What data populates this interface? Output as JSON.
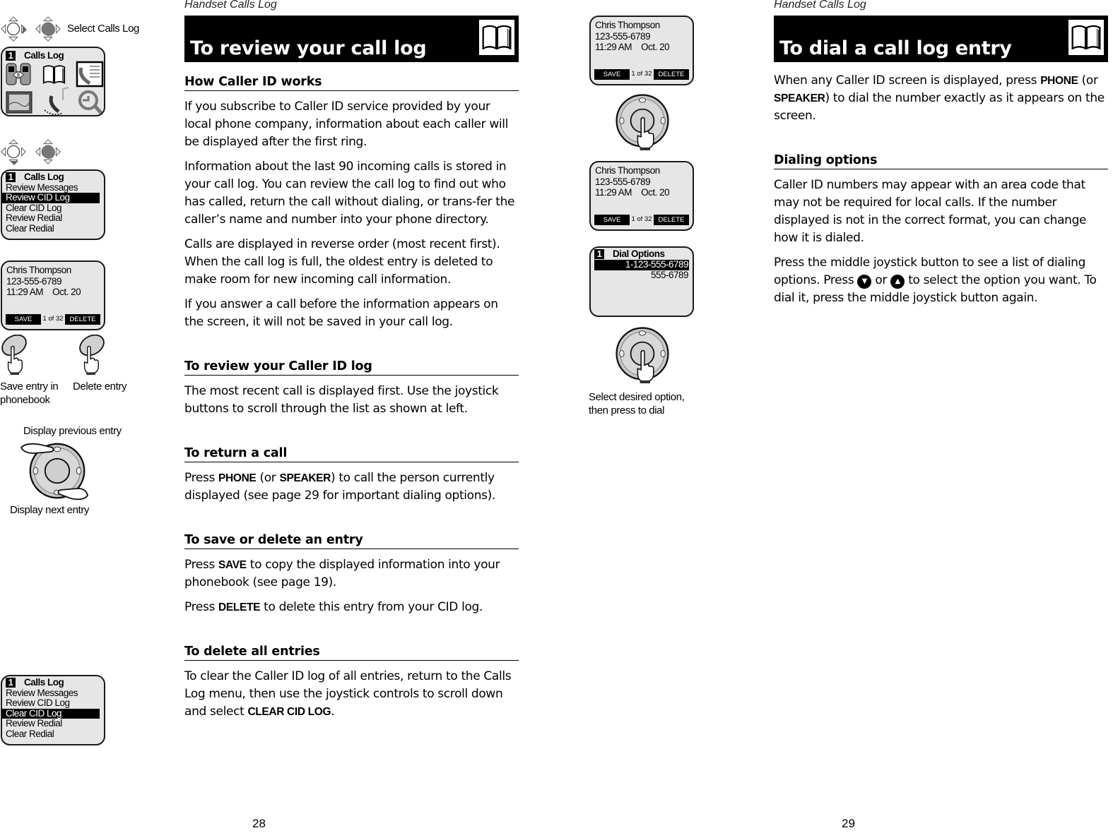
{
  "left_page": {
    "running_head": "Handset Calls Log",
    "page_number": "28",
    "banner_title": "To review your call log",
    "banner_icon": "open-book-icon",
    "sidebar": {
      "step1": {
        "caption": "Select Calls Log",
        "screen": {
          "number": "1",
          "title": "Calls Log",
          "icons": [
            "intercom-handsets-icon",
            "phonebook-icon",
            "calls-log-icon",
            "picture-icon",
            "ringer-icon",
            "settings-icon"
          ]
        }
      },
      "step2": {
        "screen": {
          "number": "1",
          "title": "Calls Log",
          "items": [
            "Review Messages",
            "Review CID Log",
            "Clear CID Log",
            "Review Redial",
            "Clear Redial"
          ],
          "selected_index": 1
        }
      },
      "step3": {
        "screen": {
          "name": "Chris Thompson",
          "number": "123-555-6789",
          "time": "11:29 AM",
          "date": "Oct. 20",
          "softkey_left": "SAVE",
          "counter": "1 of 32",
          "softkey_right": "DELETE"
        },
        "save_caption": "Save entry in phonebook",
        "delete_caption": "Delete entry"
      },
      "step4": {
        "prev_caption": "Display previous entry",
        "next_caption": "Display next entry"
      },
      "step5": {
        "screen": {
          "number": "1",
          "title": "Calls Log",
          "items": [
            "Review Messages",
            "Review CID Log",
            "Clear CID Log",
            "Review Redial",
            "Clear Redial"
          ],
          "selected_index": 2
        }
      }
    },
    "sections": [
      {
        "heading": "How Caller ID works",
        "paragraphs": [
          "If you subscribe to Caller ID service provided by your local phone company, information about each caller will be displayed after the first ring.",
          "Information about the last 90 incoming calls is stored in your call log. You can review the call log to find out who has called, return the call without dialing, or trans-fer the caller’s name and number into your phone directory.",
          "Calls are displayed in reverse order (most recent first). When the call log is full, the oldest entry is deleted to make room for new incoming call information.",
          "If you answer a call before the information appears on the screen, it will not be saved in your call log."
        ]
      },
      {
        "heading": "To review your Caller ID log",
        "paragraphs": [
          "The most recent call is displayed first. Use the joystick buttons to scroll through the list as shown at left."
        ]
      },
      {
        "heading": "To return a call",
        "p1_a": "Press ",
        "p1_key1": "PHONE",
        "p1_b": " (or ",
        "p1_key2": "SPEAKER",
        "p1_c": ") to call the person currently displayed (see page 29 for important dialing options)."
      },
      {
        "heading": "To save or delete an entry",
        "p1_a": "Press ",
        "p1_key": "SAVE",
        "p1_b": " to copy the displayed information into your phonebook (see page 19).",
        "p2_a": "Press ",
        "p2_key": "DELETE",
        "p2_b": " to delete this entry from your CID log."
      },
      {
        "heading": "To delete all entries",
        "p1_a": "To clear the Caller ID log of all entries, return to the Calls Log menu, then use the joystick controls to scroll down and select ",
        "p1_key": "CLEAR CID LOG",
        "p1_b": "."
      }
    ]
  },
  "right_page": {
    "running_head": "Handset Calls Log",
    "page_number": "29",
    "banner_title": "To dial a call log entry",
    "banner_icon": "open-book-icon",
    "sidebar": {
      "screen1": {
        "name": "Chris Thompson",
        "number": "123-555-6789",
        "time": "11:29 AM",
        "date": "Oct. 20",
        "softkey_left": "SAVE",
        "counter": "1 of 32",
        "softkey_right": "DELETE"
      },
      "screen2": {
        "name": "Chris Thompson",
        "number": "123-555-6789",
        "time": "11:29 AM",
        "date": "Oct. 20",
        "softkey_left": "SAVE",
        "counter": "1 of 32",
        "softkey_right": "DELETE"
      },
      "screen3": {
        "number": "1",
        "title": "Dial Options",
        "options": [
          "1-123-555-6789",
          "555-6789"
        ],
        "selected_index": 0
      },
      "caption": "Select desired option, then press to dial"
    },
    "intro": {
      "a": "When any Caller ID screen is displayed, press ",
      "key1": "PHONE",
      "b": " (or ",
      "key2": "SPEAKER",
      "c": ") to dial the number exactly as it appears on the screen."
    },
    "sections": [
      {
        "heading": "Dialing options",
        "p1": "Caller ID numbers may appear with an area code that may not be required for local calls. If the number displayed is not in the correct format, you can change how it is dialed.",
        "p2_a": "Press the middle joystick button to see a list of dialing options. Press ",
        "p2_down_icon": "▼",
        "p2_b": " or ",
        "p2_up_icon": "▲",
        "p2_c": " to select the option you want. To dial it, press the middle joystick button again."
      }
    ]
  }
}
